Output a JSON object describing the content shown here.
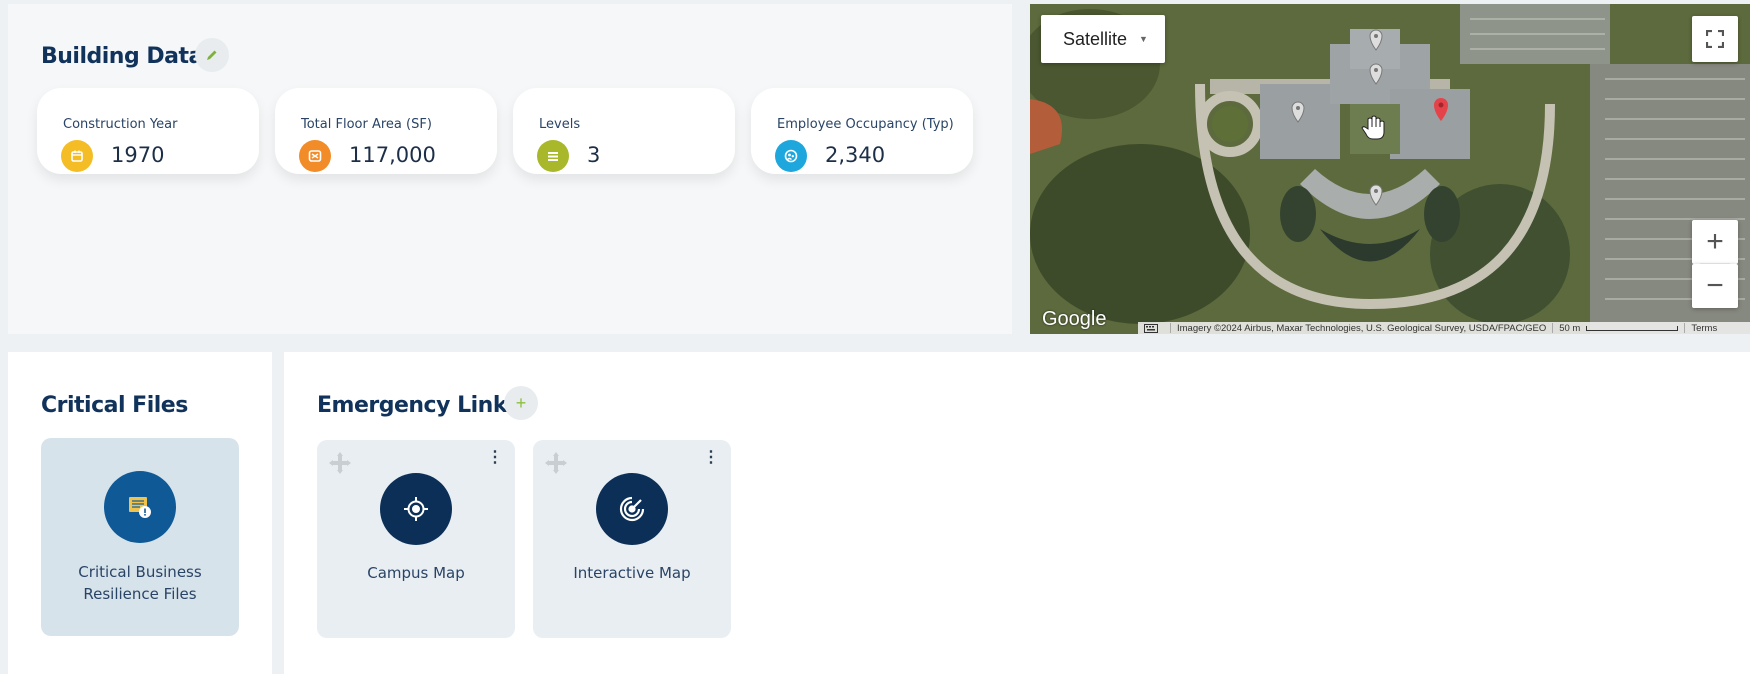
{
  "building_data": {
    "title": "Building Data",
    "stats": [
      {
        "label": "Construction Year",
        "value": "1970",
        "icon": "calendar-icon",
        "color": "#f5bd25"
      },
      {
        "label": "Total Floor Area (SF)",
        "value": "117,000",
        "icon": "floor-area-icon",
        "color": "#f28c28"
      },
      {
        "label": "Levels",
        "value": "3",
        "icon": "levels-icon",
        "color": "#a8b82a"
      },
      {
        "label": "Employee Occupancy (Typ)",
        "value": "2,340",
        "icon": "occupancy-icon",
        "color": "#1ea7dd"
      }
    ]
  },
  "map": {
    "map_type": "Satellite",
    "logo": "Google",
    "attribution": "Imagery ©2024 Airbus, Maxar Technologies, U.S. Geological Survey, USDA/FPAC/GEO",
    "scale": "50 m",
    "terms": "Terms",
    "zoom_in": "+",
    "zoom_out": "−"
  },
  "critical_files": {
    "title": "Critical Files",
    "items": [
      {
        "label": "Critical Business Resilience Files",
        "icon": "document-alert-icon"
      }
    ]
  },
  "emergency_links": {
    "title": "Emergency Links",
    "add_label": "+",
    "items": [
      {
        "label": "Campus Map",
        "icon": "target-icon"
      },
      {
        "label": "Interactive Map",
        "icon": "radar-icon"
      }
    ]
  },
  "colors": {
    "title": "#11325a",
    "files_card": "#d7e3ea",
    "files_icon": "#0f5a96",
    "link_icon": "#0c2f57",
    "accent_green": "#8bbf3f"
  }
}
